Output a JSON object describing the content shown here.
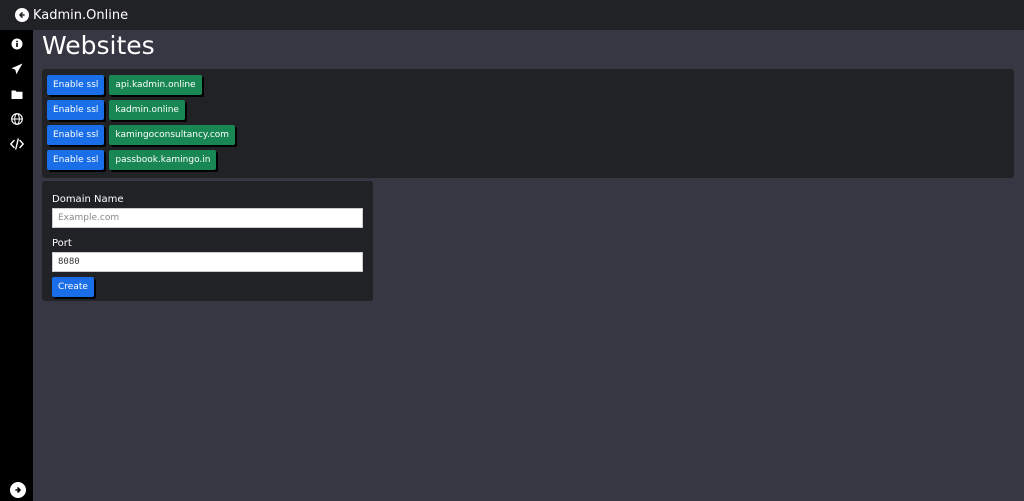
{
  "app": {
    "title": "Kadmin.Online"
  },
  "sidebar": {
    "items": [
      {
        "icon": "info-icon"
      },
      {
        "icon": "paper-plane-icon"
      },
      {
        "icon": "folder-icon"
      },
      {
        "icon": "globe-icon"
      },
      {
        "icon": "code-icon"
      }
    ],
    "bottom_icon": "arrow-right-circle-icon"
  },
  "page": {
    "title": "Websites"
  },
  "sites": [
    {
      "ssl_label": "Enable ssl",
      "domain": "api.kadmin.online"
    },
    {
      "ssl_label": "Enable ssl",
      "domain": "kadmin.online"
    },
    {
      "ssl_label": "Enable ssl",
      "domain": "kamingoconsultancy.com"
    },
    {
      "ssl_label": "Enable ssl",
      "domain": "passbook.kamingo.in"
    }
  ],
  "form": {
    "domain_label": "Domain Name",
    "domain_placeholder": "Example.com",
    "domain_value": "",
    "port_label": "Port",
    "port_placeholder": "",
    "port_value": "8080",
    "create_label": "Create"
  },
  "colors": {
    "primary": "#1a6fe8",
    "success": "#198754",
    "panel": "#212226",
    "background": "#373743"
  }
}
